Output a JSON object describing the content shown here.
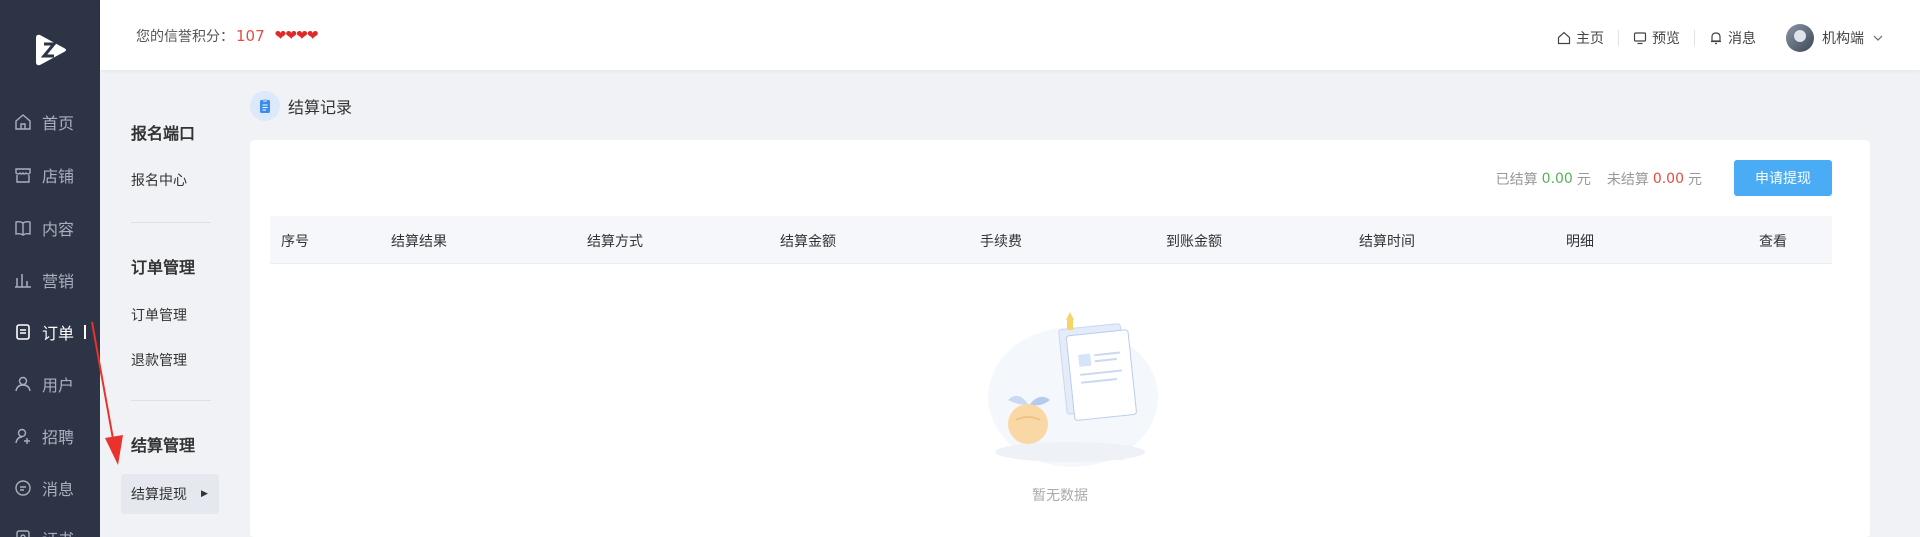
{
  "nav": {
    "items": [
      {
        "label": "首页",
        "icon": "home-icon"
      },
      {
        "label": "店铺",
        "icon": "store-icon"
      },
      {
        "label": "内容",
        "icon": "book-icon"
      },
      {
        "label": "营销",
        "icon": "bar-chart-icon"
      },
      {
        "label": "订单",
        "icon": "order-icon",
        "active": true
      },
      {
        "label": "用户",
        "icon": "user-icon"
      },
      {
        "label": "招聘",
        "icon": "recruit-icon"
      },
      {
        "label": "消息",
        "icon": "message-icon"
      },
      {
        "label": "证书",
        "icon": "certificate-icon"
      }
    ]
  },
  "header": {
    "credit_label": "您的信誉积分：",
    "credit_score": "107",
    "hearts": "❤❤❤❤",
    "links": {
      "home": "主页",
      "preview": "预览",
      "messages": "消息"
    },
    "user_name": "机构端"
  },
  "submenu": {
    "groups": [
      {
        "title": "报名端口",
        "items": [
          "报名中心"
        ]
      },
      {
        "title": "订单管理",
        "items": [
          "订单管理",
          "退款管理"
        ]
      },
      {
        "title": "结算管理",
        "items": [
          "结算提现"
        ]
      }
    ]
  },
  "page": {
    "title": "结算记录",
    "settled_label": "已结算",
    "settled_value": "0.00",
    "unsettled_label": "未结算",
    "unsettled_value": "0.00",
    "currency": "元",
    "apply_button": "申请提现",
    "columns": [
      "序号",
      "结算结果",
      "结算方式",
      "结算金额",
      "手续费",
      "到账金额",
      "结算时间",
      "明细",
      "查看"
    ],
    "empty_text": "暂无数据"
  },
  "colors": {
    "nav_bg": "#2c3446",
    "accent_button": "#4aacf4",
    "settled_green": "#52b552",
    "unsettled_red": "#e34d43"
  }
}
